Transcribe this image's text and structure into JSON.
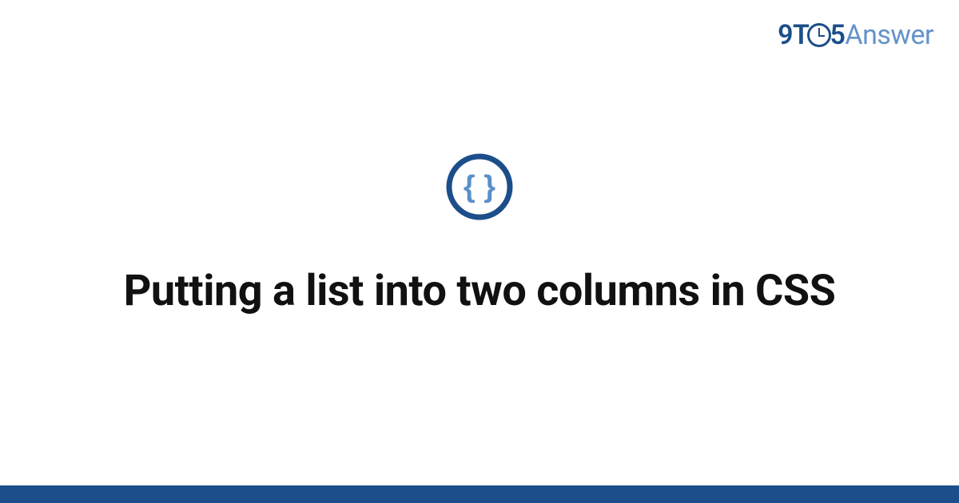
{
  "logo": {
    "part1": "9T",
    "part2": "5",
    "part3": "Answer"
  },
  "badge": {
    "icon_name": "css-braces-icon"
  },
  "title": "Putting a list into two columns in CSS",
  "colors": {
    "brand_dark": "#1c4e8a",
    "brand_light": "#6393c9",
    "text": "#111111",
    "background": "#ffffff"
  }
}
